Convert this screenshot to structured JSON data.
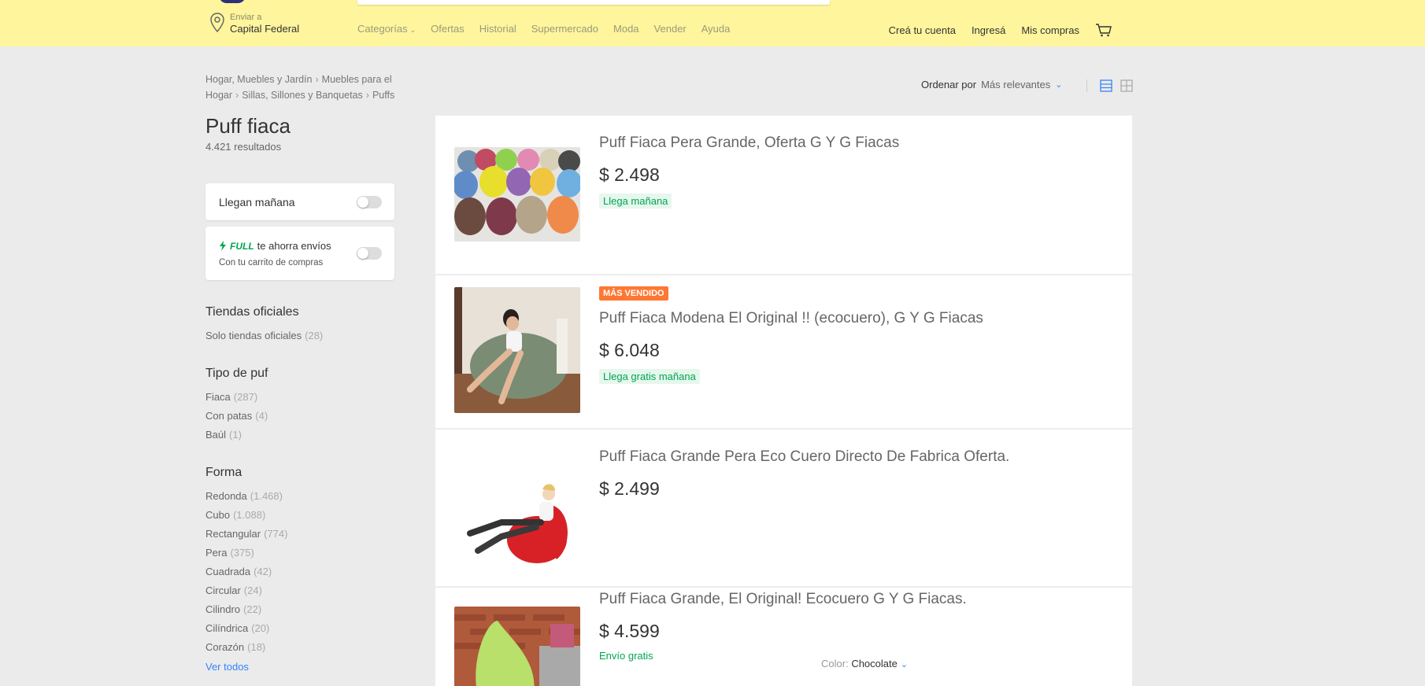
{
  "header": {
    "location_small": "Enviar a",
    "location_big": "Capital Federal",
    "nav": [
      "Categorías",
      "Ofertas",
      "Historial",
      "Supermercado",
      "Moda",
      "Vender",
      "Ayuda"
    ],
    "user_nav": [
      "Creá tu cuenta",
      "Ingresá",
      "Mis compras"
    ]
  },
  "breadcrumb": {
    "items": [
      "Hogar, Muebles y Jardín",
      "Muebles para el Hogar",
      "Sillas, Sillones y Banquetas",
      "Puffs"
    ]
  },
  "sort": {
    "label": "Ordenar por",
    "value": "Más relevantes"
  },
  "search": {
    "title": "Puff fiaca",
    "count": "4.421 resultados"
  },
  "filters": {
    "llegan_manana": "Llegan mañana",
    "full_badge": "FULL",
    "full_text": "te ahorra envíos",
    "full_sub": "Con tu carrito de compras",
    "groups": [
      {
        "title": "Tiendas oficiales",
        "items": [
          {
            "label": "Solo tiendas oficiales",
            "count": "(28)"
          }
        ]
      },
      {
        "title": "Tipo de puf",
        "items": [
          {
            "label": "Fiaca",
            "count": "(287)"
          },
          {
            "label": "Con patas",
            "count": "(4)"
          },
          {
            "label": "Baúl",
            "count": "(1)"
          }
        ]
      },
      {
        "title": "Forma",
        "items": [
          {
            "label": "Redonda",
            "count": "(1.468)"
          },
          {
            "label": "Cubo",
            "count": "(1.088)"
          },
          {
            "label": "Rectangular",
            "count": "(774)"
          },
          {
            "label": "Pera",
            "count": "(375)"
          },
          {
            "label": "Cuadrada",
            "count": "(42)"
          },
          {
            "label": "Circular",
            "count": "(24)"
          },
          {
            "label": "Cilindro",
            "count": "(22)"
          },
          {
            "label": "Cilíndrica",
            "count": "(20)"
          },
          {
            "label": "Corazón",
            "count": "(18)"
          }
        ]
      }
    ],
    "ver_todos": "Ver todos"
  },
  "results": [
    {
      "title": "Puff Fiaca Pera Grande, Oferta G Y G Fiacas",
      "price": "$ 2.498",
      "shipping": "Llega mañana",
      "badge": ""
    },
    {
      "title": "Puff Fiaca Modena El Original !! (ecocuero), G Y G Fiacas",
      "price": "$ 6.048",
      "shipping": "Llega gratis mañana",
      "badge": "MÁS VENDIDO"
    },
    {
      "title": "Puff Fiaca Grande Pera Eco Cuero Directo De Fabrica Oferta.",
      "price": "$ 2.499",
      "shipping": "",
      "badge": ""
    },
    {
      "title": "Puff Fiaca Grande, El Original! Ecocuero G Y G Fiacas.",
      "price": "$ 4.599",
      "shipping": "Envío gratis",
      "badge": ""
    }
  ],
  "color_selector": {
    "label": "Color:",
    "value": "Chocolate"
  },
  "colors": {
    "header_bg": "#fff59d",
    "accent": "#3483fa",
    "shipping_green": "#00a650",
    "badge_orange": "#ff7733"
  }
}
